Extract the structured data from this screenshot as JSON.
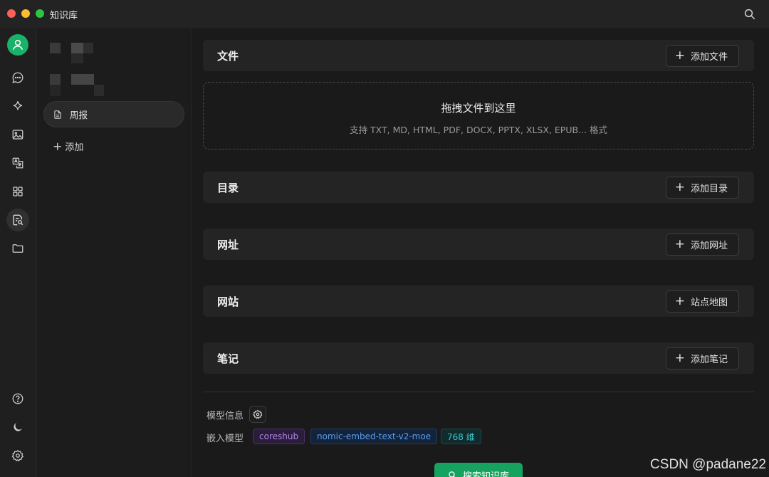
{
  "window": {
    "title": "知识库"
  },
  "colors": {
    "accent": "#16a25f",
    "avatar": "#18b26a"
  },
  "rail": {
    "items": [
      "user-avatar",
      "chat-icon",
      "sparkle-icon",
      "image-icon",
      "translate-icon",
      "apps-icon",
      "knowledge-icon",
      "folder-icon",
      "help-icon",
      "moon-icon",
      "settings-icon"
    ],
    "active": "knowledge-icon"
  },
  "list": {
    "items": [
      {
        "label": "周报",
        "icon": "document-icon"
      }
    ],
    "add_label": "添加"
  },
  "sections": {
    "files": {
      "title": "文件",
      "button": "添加文件"
    },
    "dropzone": {
      "title": "拖拽文件到这里",
      "subtitle": "支持 TXT, MD, HTML, PDF, DOCX, PPTX, XLSX, EPUB... 格式"
    },
    "directory": {
      "title": "目录",
      "button": "添加目录"
    },
    "url": {
      "title": "网址",
      "button": "添加网址"
    },
    "website": {
      "title": "网站",
      "button": "站点地图"
    },
    "notes": {
      "title": "笔记",
      "button": "添加笔记"
    }
  },
  "model": {
    "info_label": "模型信息",
    "embed_label": "嵌入模型",
    "provider": "coreshub",
    "model_name": "nomic-embed-text-v2-moe",
    "dimension": "768 维"
  },
  "actions": {
    "search_kb": "搜索知识库"
  },
  "watermark": "CSDN @padane22"
}
